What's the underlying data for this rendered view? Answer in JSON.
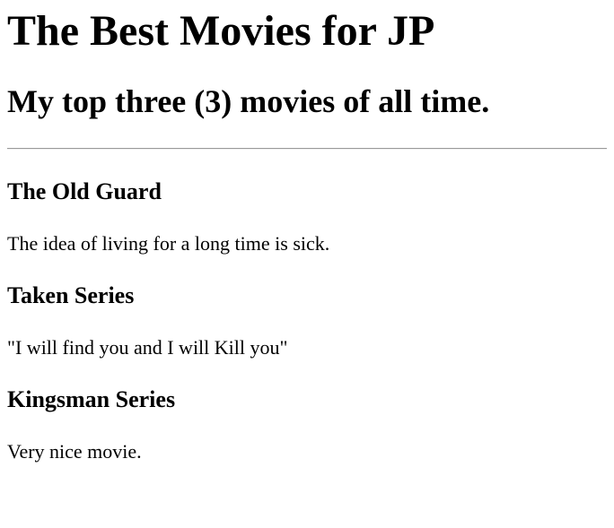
{
  "page": {
    "title": "The Best Movies for JP",
    "subtitle": "My top three (3) movies of all time."
  },
  "movies": [
    {
      "title": "The Old Guard",
      "description": "The idea of living for a long time is sick."
    },
    {
      "title": "Taken Series",
      "description": "\"I will find you and I will Kill you\""
    },
    {
      "title": "Kingsman Series",
      "description": "Very nice movie."
    }
  ]
}
